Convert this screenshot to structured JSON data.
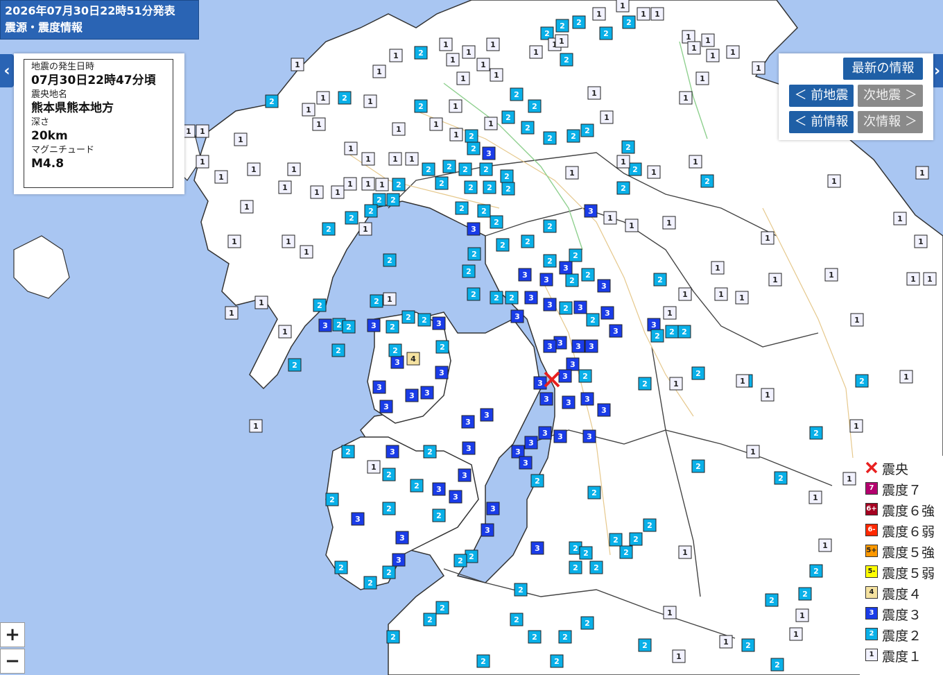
{
  "banner": {
    "line1": "2026年07月30日22時51分発表",
    "line2": "震源・震度情報"
  },
  "info": {
    "time_label": "地震の発生日時",
    "time_value": "07月30日22時47分頃",
    "place_label": "震央地名",
    "place_value": "熊本県熊本地方",
    "depth_label": "深さ",
    "depth_value": "20km",
    "mag_label": "マグニチュード",
    "mag_value": "M4.8"
  },
  "nav": {
    "latest": "最新の情報",
    "prev_quake": "＜ 前地震",
    "next_quake": "次地震 ＞",
    "prev_info": "＜ 前情報",
    "next_info": "次情報 ＞"
  },
  "arrows": {
    "left": "‹",
    "right": "›"
  },
  "zoom": {
    "in": "+",
    "out": "−"
  },
  "legend": {
    "epicenter": "震央",
    "items": [
      {
        "code": "7",
        "label": "震度７",
        "color": "#b4006e",
        "text_color": "#ffffff"
      },
      {
        "code": "6+",
        "label": "震度６強",
        "color": "#a50021",
        "text_color": "#ffffff"
      },
      {
        "code": "6-",
        "label": "震度６弱",
        "color": "#ff2800",
        "text_color": "#ffffff"
      },
      {
        "code": "5+",
        "label": "震度５強",
        "color": "#ff9900",
        "text_color": "#222222"
      },
      {
        "code": "5-",
        "label": "震度５弱",
        "color": "#ffff00",
        "text_color": "#222222"
      },
      {
        "code": "4",
        "label": "震度４",
        "color": "#f5e2a0",
        "text_color": "#222222"
      },
      {
        "code": "3",
        "label": "震度３",
        "color": "#1a3ce8",
        "text_color": "#ffffff"
      },
      {
        "code": "2",
        "label": "震度２",
        "color": "#0ab0e8",
        "text_color": "#ffffff"
      },
      {
        "code": "1",
        "label": "震度１",
        "color": "#f2f2ff",
        "text_color": "#222222"
      }
    ]
  },
  "colors": {
    "sea": "#a9c6f2",
    "land": "#ffffff",
    "coast": "#222222",
    "epicenter": "#e82020",
    "intensity3": "#1a3ce8",
    "intensity2": "#0ab0e8"
  }
}
